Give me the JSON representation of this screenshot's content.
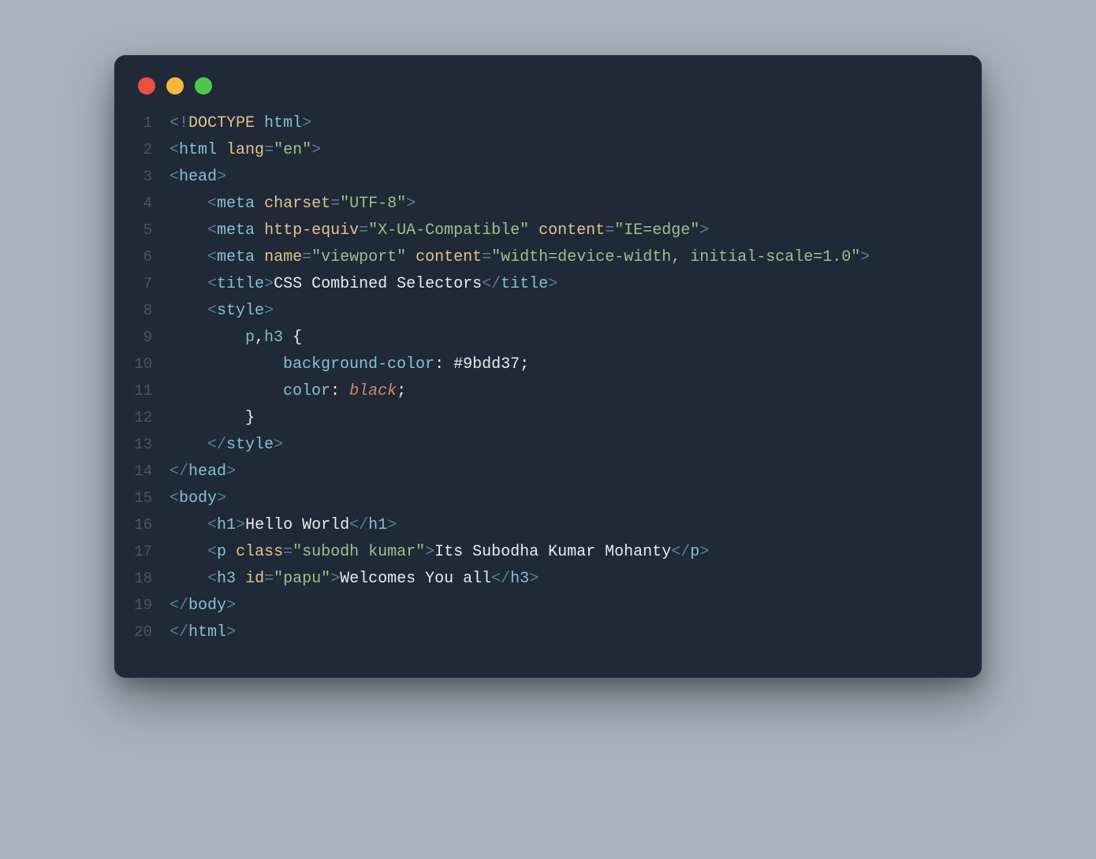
{
  "window": {
    "dots": [
      "red",
      "yellow",
      "green"
    ]
  },
  "code": {
    "lines": [
      {
        "n": 1,
        "tokens": [
          {
            "c": "pun",
            "t": "<!"
          },
          {
            "c": "kw",
            "t": "DOCTYPE"
          },
          {
            "c": "txt",
            "t": " "
          },
          {
            "c": "tag",
            "t": "html"
          },
          {
            "c": "pun",
            "t": ">"
          }
        ]
      },
      {
        "n": 2,
        "tokens": [
          {
            "c": "pun",
            "t": "<"
          },
          {
            "c": "tag",
            "t": "html"
          },
          {
            "c": "txt",
            "t": " "
          },
          {
            "c": "attr",
            "t": "lang"
          },
          {
            "c": "pun",
            "t": "="
          },
          {
            "c": "str",
            "t": "\"en\""
          },
          {
            "c": "pun",
            "t": ">"
          }
        ]
      },
      {
        "n": 3,
        "tokens": [
          {
            "c": "pun",
            "t": "<"
          },
          {
            "c": "tag",
            "t": "head"
          },
          {
            "c": "pun",
            "t": ">"
          }
        ]
      },
      {
        "n": 4,
        "tokens": [
          {
            "c": "txt",
            "t": "    "
          },
          {
            "c": "pun",
            "t": "<"
          },
          {
            "c": "tag",
            "t": "meta"
          },
          {
            "c": "txt",
            "t": " "
          },
          {
            "c": "attr",
            "t": "charset"
          },
          {
            "c": "pun",
            "t": "="
          },
          {
            "c": "str",
            "t": "\"UTF-8\""
          },
          {
            "c": "pun",
            "t": ">"
          }
        ]
      },
      {
        "n": 5,
        "tokens": [
          {
            "c": "txt",
            "t": "    "
          },
          {
            "c": "pun",
            "t": "<"
          },
          {
            "c": "tag",
            "t": "meta"
          },
          {
            "c": "txt",
            "t": " "
          },
          {
            "c": "attr",
            "t": "http-equiv"
          },
          {
            "c": "pun",
            "t": "="
          },
          {
            "c": "str",
            "t": "\"X-UA-Compatible\""
          },
          {
            "c": "txt",
            "t": " "
          },
          {
            "c": "attr",
            "t": "content"
          },
          {
            "c": "pun",
            "t": "="
          },
          {
            "c": "str",
            "t": "\"IE=edge\""
          },
          {
            "c": "pun",
            "t": ">"
          }
        ]
      },
      {
        "n": 6,
        "tokens": [
          {
            "c": "txt",
            "t": "    "
          },
          {
            "c": "pun",
            "t": "<"
          },
          {
            "c": "tag",
            "t": "meta"
          },
          {
            "c": "txt",
            "t": " "
          },
          {
            "c": "attr",
            "t": "name"
          },
          {
            "c": "pun",
            "t": "="
          },
          {
            "c": "str",
            "t": "\"viewport\""
          },
          {
            "c": "txt",
            "t": " "
          },
          {
            "c": "attr",
            "t": "content"
          },
          {
            "c": "pun",
            "t": "="
          },
          {
            "c": "str",
            "t": "\"width=device-width, initial-scale=1.0\""
          },
          {
            "c": "pun",
            "t": ">"
          }
        ]
      },
      {
        "n": 7,
        "tokens": [
          {
            "c": "txt",
            "t": "    "
          },
          {
            "c": "pun",
            "t": "<"
          },
          {
            "c": "tag",
            "t": "title"
          },
          {
            "c": "pun",
            "t": ">"
          },
          {
            "c": "txt",
            "t": "CSS Combined Selectors"
          },
          {
            "c": "pun",
            "t": "</"
          },
          {
            "c": "tag",
            "t": "title"
          },
          {
            "c": "pun",
            "t": ">"
          }
        ]
      },
      {
        "n": 8,
        "tokens": [
          {
            "c": "txt",
            "t": "    "
          },
          {
            "c": "pun",
            "t": "<"
          },
          {
            "c": "tag",
            "t": "style"
          },
          {
            "c": "pun",
            "t": ">"
          }
        ]
      },
      {
        "n": 9,
        "tokens": [
          {
            "c": "txt",
            "t": "        "
          },
          {
            "c": "sel",
            "t": "p"
          },
          {
            "c": "punw",
            "t": ","
          },
          {
            "c": "sel",
            "t": "h3"
          },
          {
            "c": "txt",
            "t": " "
          },
          {
            "c": "punw",
            "t": "{"
          }
        ]
      },
      {
        "n": 10,
        "tokens": [
          {
            "c": "txt",
            "t": "            "
          },
          {
            "c": "prop",
            "t": "background-color"
          },
          {
            "c": "punw",
            "t": ": "
          },
          {
            "c": "val",
            "t": "#9bdd37"
          },
          {
            "c": "punw",
            "t": ";"
          }
        ]
      },
      {
        "n": 11,
        "tokens": [
          {
            "c": "txt",
            "t": "            "
          },
          {
            "c": "prop",
            "t": "color"
          },
          {
            "c": "punw",
            "t": ": "
          },
          {
            "c": "ital",
            "t": "black"
          },
          {
            "c": "punw",
            "t": ";"
          }
        ]
      },
      {
        "n": 12,
        "tokens": [
          {
            "c": "txt",
            "t": "        "
          },
          {
            "c": "punw",
            "t": "}"
          }
        ]
      },
      {
        "n": 13,
        "tokens": [
          {
            "c": "txt",
            "t": "    "
          },
          {
            "c": "pun",
            "t": "</"
          },
          {
            "c": "tag",
            "t": "style"
          },
          {
            "c": "pun",
            "t": ">"
          }
        ]
      },
      {
        "n": 14,
        "tokens": [
          {
            "c": "pun",
            "t": "</"
          },
          {
            "c": "tag",
            "t": "head"
          },
          {
            "c": "pun",
            "t": ">"
          }
        ]
      },
      {
        "n": 15,
        "tokens": [
          {
            "c": "pun",
            "t": "<"
          },
          {
            "c": "tag",
            "t": "body"
          },
          {
            "c": "pun",
            "t": ">"
          }
        ]
      },
      {
        "n": 16,
        "tokens": [
          {
            "c": "txt",
            "t": "    "
          },
          {
            "c": "pun",
            "t": "<"
          },
          {
            "c": "tag",
            "t": "h1"
          },
          {
            "c": "pun",
            "t": ">"
          },
          {
            "c": "txt",
            "t": "Hello World"
          },
          {
            "c": "pun",
            "t": "</"
          },
          {
            "c": "tag",
            "t": "h1"
          },
          {
            "c": "pun",
            "t": ">"
          }
        ]
      },
      {
        "n": 17,
        "tokens": [
          {
            "c": "txt",
            "t": "    "
          },
          {
            "c": "pun",
            "t": "<"
          },
          {
            "c": "tag",
            "t": "p"
          },
          {
            "c": "txt",
            "t": " "
          },
          {
            "c": "attr",
            "t": "class"
          },
          {
            "c": "pun",
            "t": "="
          },
          {
            "c": "str",
            "t": "\"subodh kumar\""
          },
          {
            "c": "pun",
            "t": ">"
          },
          {
            "c": "txt",
            "t": "Its Subodha Kumar Mohanty"
          },
          {
            "c": "pun",
            "t": "</"
          },
          {
            "c": "tag",
            "t": "p"
          },
          {
            "c": "pun",
            "t": ">"
          }
        ]
      },
      {
        "n": 18,
        "tokens": [
          {
            "c": "txt",
            "t": "    "
          },
          {
            "c": "pun",
            "t": "<"
          },
          {
            "c": "tag",
            "t": "h3"
          },
          {
            "c": "txt",
            "t": " "
          },
          {
            "c": "attr",
            "t": "id"
          },
          {
            "c": "pun",
            "t": "="
          },
          {
            "c": "str",
            "t": "\"papu\""
          },
          {
            "c": "pun",
            "t": ">"
          },
          {
            "c": "txt",
            "t": "Welcomes You all"
          },
          {
            "c": "pun",
            "t": "</"
          },
          {
            "c": "tag",
            "t": "h3"
          },
          {
            "c": "pun",
            "t": ">"
          }
        ]
      },
      {
        "n": 19,
        "tokens": [
          {
            "c": "pun",
            "t": "</"
          },
          {
            "c": "tag",
            "t": "body"
          },
          {
            "c": "pun",
            "t": ">"
          }
        ]
      },
      {
        "n": 20,
        "tokens": [
          {
            "c": "pun",
            "t": "</"
          },
          {
            "c": "tag",
            "t": "html"
          },
          {
            "c": "pun",
            "t": ">"
          }
        ]
      }
    ]
  }
}
